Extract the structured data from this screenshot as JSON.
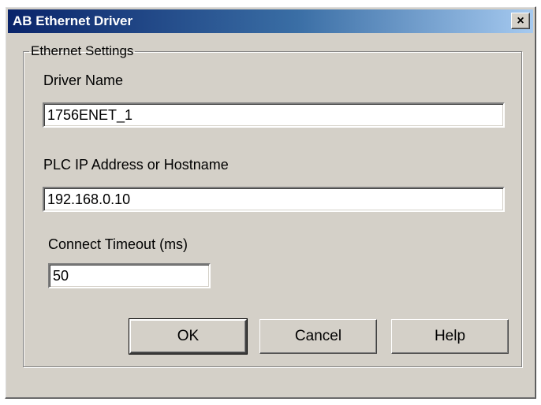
{
  "window": {
    "title": "AB Ethernet Driver",
    "close_symbol": "×"
  },
  "group": {
    "legend": "Ethernet Settings"
  },
  "driver_name": {
    "label": "Driver Name",
    "value": "1756ENET_1"
  },
  "plc_address": {
    "label": "PLC IP Address or Hostname",
    "value": "192.168.0.10"
  },
  "timeout": {
    "label": "Connect Timeout (ms)",
    "value": "50"
  },
  "buttons": {
    "ok": "OK",
    "cancel": "Cancel",
    "help": "Help"
  },
  "colors": {
    "dialog_face": "#d4d0c8",
    "title_start": "#0a246a",
    "title_end": "#a6caf0"
  }
}
